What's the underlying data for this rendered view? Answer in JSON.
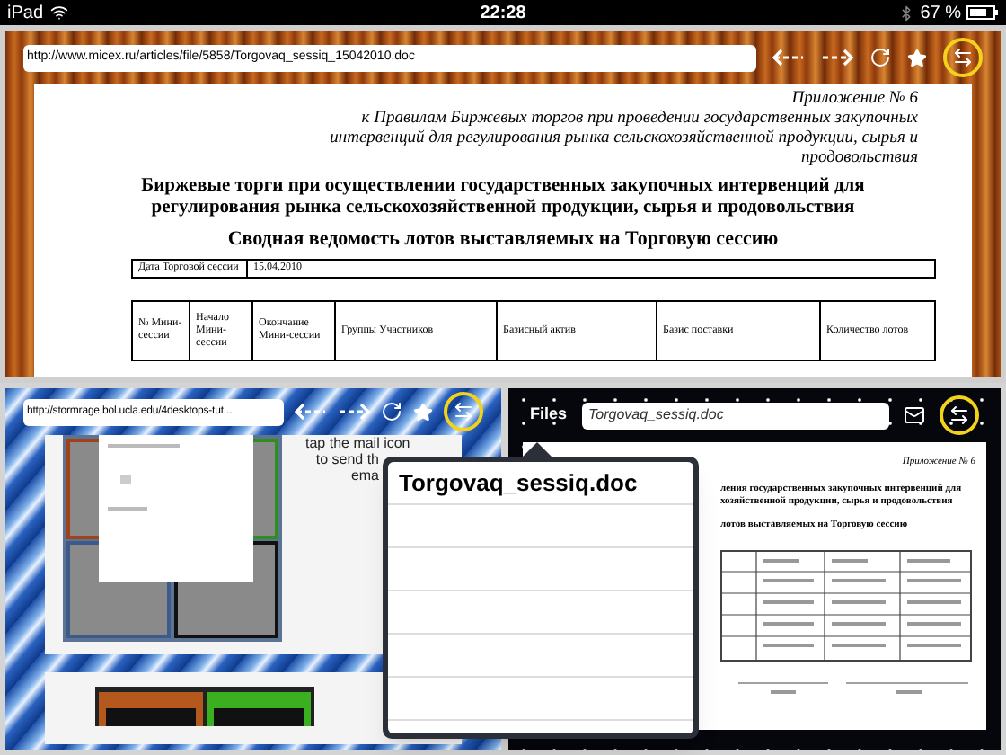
{
  "status_bar": {
    "device": "iPad",
    "time": "22:28",
    "battery": "67 %"
  },
  "top_browser": {
    "url": "http://www.micex.ru/articles/file/5858/Torgovaq_sessiq_15042010.doc",
    "document": {
      "appendix": [
        "Приложение № 6",
        "к Правилам Биржевых торгов при проведении государственных закупочных",
        "интервенций для регулирования рынка сельскохозяйственной продукции, сырья и",
        "продовольствия"
      ],
      "heading": [
        "Биржевые торги при осуществлении государственных закупочных интервенций для",
        "регулирования рынка сельскохозяйственной продукции, сырья и продовольствия"
      ],
      "subheading": "Сводная ведомость лотов выставляемых на Торговую сессию",
      "date_label": "Дата Торговой сессии",
      "date_value": "15.04.2010",
      "columns": [
        "№ Мини-сессии",
        "Начало Мини-сессии",
        "Окончание Мини-сессии",
        "Группы Участников",
        "Базисный актив",
        "Базис поставки",
        "Количество лотов"
      ]
    }
  },
  "left_browser": {
    "url": "http://stormrage.bol.ucla.edu/4desktops-tut...",
    "page_text": [
      "tap the mail icon",
      "to send th",
      "ema"
    ]
  },
  "right_viewer": {
    "files_button": "Files",
    "file_name": "Torgovaq_sessiq.doc",
    "document": {
      "appendix": "Приложение № 6",
      "heading": [
        "ления государственных закупочных интервенций для",
        "хозяйственной продукции, сырья и продовольствия"
      ],
      "subheading": "лотов выставляемых на Торговую сессию"
    }
  },
  "popover": {
    "title": "Torgovaq_sessiq.doc"
  }
}
